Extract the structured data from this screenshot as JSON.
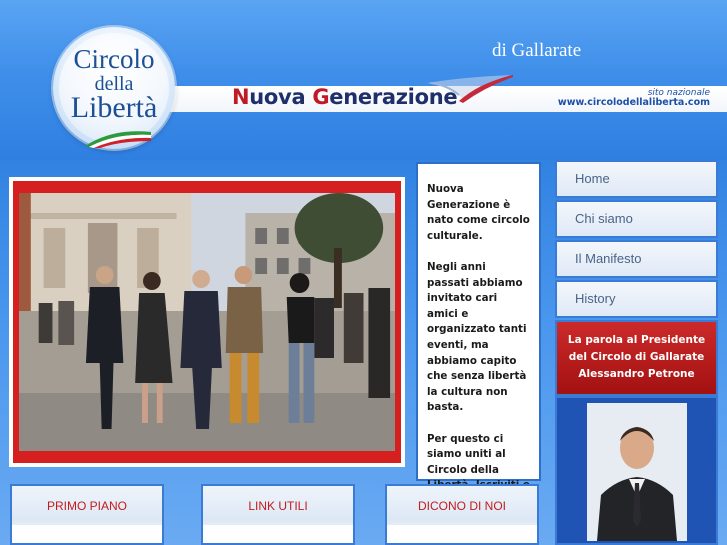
{
  "header": {
    "logo": {
      "line1": "Circolo",
      "line2": "della",
      "line3": "Libertà"
    },
    "subtitle": "di Gallarate",
    "banner": {
      "first_letter": "N",
      "rest1": "uova ",
      "second_letter": "G",
      "rest2": "enerazione"
    },
    "national": {
      "label": "sito nazionale",
      "url": "www.circolodellaliberta.com"
    }
  },
  "intro": {
    "paragraphs": [
      "Nuova Generazione è nato come circolo culturale.",
      "Negli anni passati abbiamo invitato cari amici e organizzato tanti eventi, ma abbiamo capito che senza libertà la cultura non basta.",
      "Per questo ci siamo uniti al Circolo della Libertà. Iscriviti e ti informaremo sulle nostre iniziative."
    ]
  },
  "nav": {
    "items": [
      {
        "label": "Home"
      },
      {
        "label": "Chi siamo"
      },
      {
        "label": "Il Manifesto"
      },
      {
        "label": "History"
      }
    ]
  },
  "president": {
    "line1": "La parola al Presidente",
    "line2": "del Circolo di Gallarate",
    "line3": "Alessandro Petrone"
  },
  "tabs": [
    {
      "label": "PRIMO PIANO"
    },
    {
      "label": "LINK UTILI"
    },
    {
      "label": "DICONO DI NOI"
    }
  ],
  "colors": {
    "background": "#2e7fe0",
    "nav_border": "#3a7bd5",
    "accent_red": "#c41b1b",
    "banner_navy": "#1f2f6b"
  }
}
